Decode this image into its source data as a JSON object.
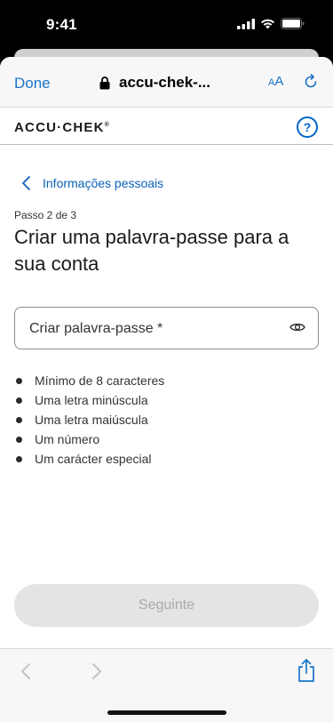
{
  "status_bar": {
    "time": "9:41"
  },
  "browser": {
    "done_label": "Done",
    "url": "accu-chek-...",
    "text_size_label_small": "A",
    "text_size_label_large": "A"
  },
  "site": {
    "logo": "ACCU·CHEK",
    "logo_mark": "®",
    "help_label": "?"
  },
  "nav": {
    "back_label": "Informações pessoais"
  },
  "page": {
    "step": "Passo 2 de 3",
    "title": "Criar uma palavra-passe para a sua conta"
  },
  "form": {
    "password_placeholder": "Criar palavra-passe *"
  },
  "requirements": [
    "Mínimo de 8 caracteres",
    "Uma letra minúscula",
    "Uma letra maiúscula",
    "Um número",
    "Um carácter especial"
  ],
  "actions": {
    "next_label": "Seguinte"
  },
  "colors": {
    "accent": "#0066cc",
    "link": "#1a73c8",
    "disabled_bg": "#e4e4e4",
    "disabled_text": "#aaaaaa"
  }
}
